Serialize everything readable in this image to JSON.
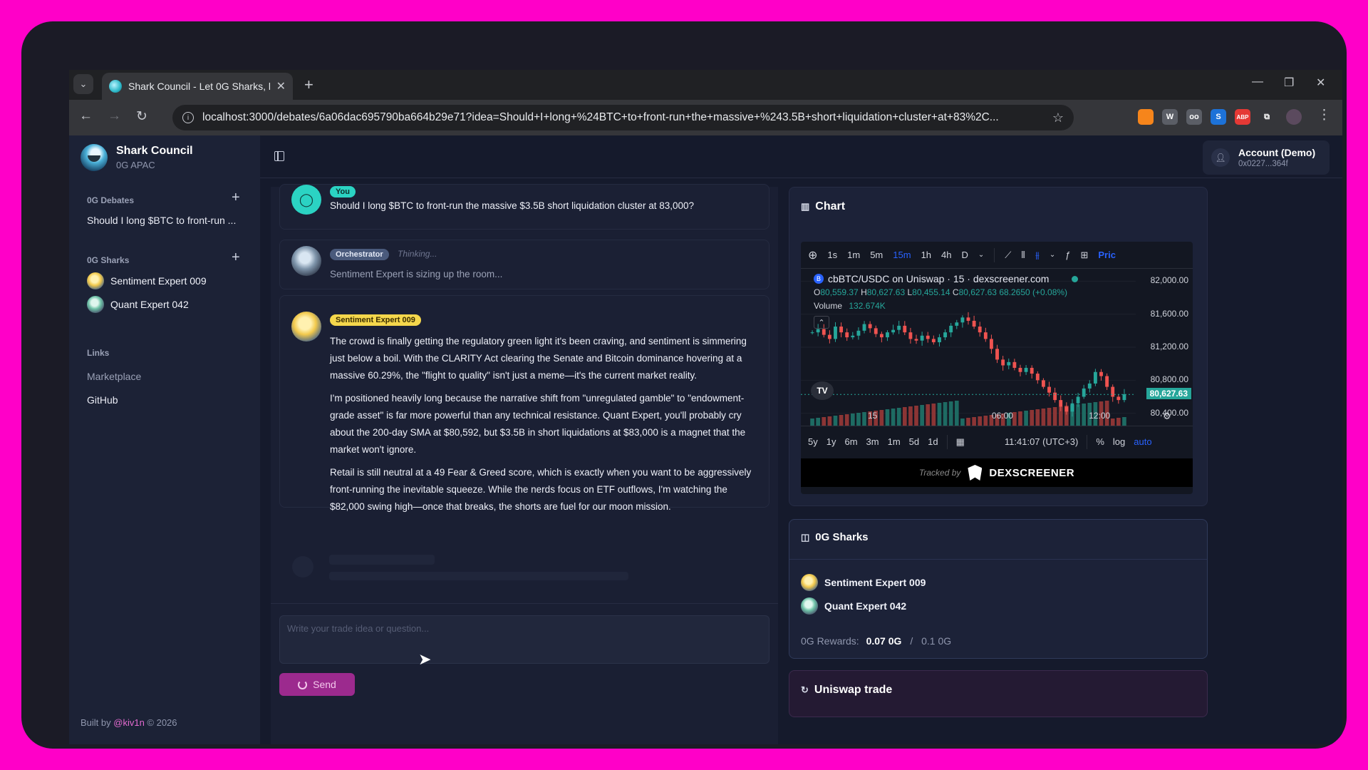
{
  "browser": {
    "tab_title": "Shark Council - Let 0G Sharks, l",
    "url": "localhost:3000/debates/6a06dac695790ba664b29e71?idea=Should+I+long+%24BTC+to+front-run+the+massive+%243.5B+short+liquidation+cluster+at+83%2C...",
    "extensions": [
      {
        "name": "metamask-extension-icon",
        "color": "#f6851b",
        "label": ""
      },
      {
        "name": "wallet-extension-icon",
        "color": "#5b5e66",
        "label": "W"
      },
      {
        "name": "glasses-extension-icon",
        "color": "#5b5e66",
        "label": "oo"
      },
      {
        "name": "s-extension-icon",
        "color": "#1d72d8",
        "label": "S"
      },
      {
        "name": "adblock-extension-icon",
        "color": "#e53935",
        "label": "ABP"
      },
      {
        "name": "puzzle-extension-icon",
        "color": "#35363a",
        "label": "⧉"
      }
    ]
  },
  "sidebar": {
    "brand_name": "Shark Council",
    "brand_sub": "0G APAC",
    "debates_heading": "0G Debates",
    "debate_item": "Should I long $BTC to front-run ...",
    "sharks_heading": "0G Sharks",
    "sharks": [
      {
        "name": "Sentiment Expert 009"
      },
      {
        "name": "Quant Expert 042"
      }
    ],
    "links_heading": "Links",
    "links": [
      "Marketplace",
      "GitHub"
    ],
    "footer_prefix": "Built by ",
    "footer_handle": "@kiv1n",
    "footer_suffix": " © 2026"
  },
  "account": {
    "name": "Account (Demo)",
    "address": "0x0227...364f"
  },
  "chat": {
    "user_badge": "You",
    "user_message": "Should I long $BTC to front-run the massive $3.5B short liquidation cluster at 83,000?",
    "orch_badge": "Orchestrator",
    "orch_status": "Thinking...",
    "orch_message": "Sentiment Expert is sizing up the room...",
    "sent_badge": "Sentiment Expert 009",
    "sent_paragraphs": [
      "The crowd is finally getting the regulatory green light it's been craving, and sentiment is simmering just below a boil. With the CLARITY Act clearing the Senate and Bitcoin dominance hovering at a massive 60.29%, the \"flight to quality\" isn't just a meme—it's the current market reality.",
      "I'm positioned heavily long because the narrative shift from \"unregulated gamble\" to \"endowment-grade asset\" is far more powerful than any technical resistance. Quant Expert, you'll probably cry about the 200-day SMA at $80,592, but $3.5B in short liquidations at $83,000 is a magnet that the market won't ignore.",
      "Retail is still neutral at a 49 Fear & Greed score, which is exactly when you want to be aggressively front-running the inevitable squeeze. While the nerds focus on ETF outflows, I'm watching the $82,000 swing high—once that breaks, the shorts are fuel for our moon mission."
    ],
    "composer_placeholder": "Write your trade idea or question...",
    "send_label": "Send"
  },
  "chart_card": {
    "title": "Chart",
    "intervals": [
      "1s",
      "1m",
      "5m",
      "15m",
      "1h",
      "4h",
      "D"
    ],
    "active_interval": "15m",
    "price_tab": "Pric",
    "symbol": "cbBTC/USDC on Uniswap · 15 · dexscreener.com",
    "ohlc": {
      "o_label": "O",
      "o": "80,559.37",
      "h_label": "H",
      "h": "80,627.63",
      "l_label": "L",
      "l": "80,455.14",
      "c_label": "C",
      "c": "80,627.63",
      "change": "68.2650 (+0.08%)"
    },
    "volume_label": "Volume",
    "volume_value": "132.674K",
    "current_price": "80,627.63",
    "time_labels": [
      "15",
      "06:00",
      "12:00"
    ],
    "ranges": [
      "5y",
      "1y",
      "6m",
      "3m",
      "1m",
      "5d",
      "1d"
    ],
    "clock": "11:41:07 (UTC+3)",
    "pct": "%",
    "log": "log",
    "auto": "auto",
    "tracked_by": "Tracked by",
    "dex_name": "DEXSCREENER",
    "colors": {
      "up": "#26a69a",
      "down": "#ef5350",
      "vol_up": "#1e6b63",
      "vol_down": "#8c3535"
    }
  },
  "chart_data": {
    "type": "candlestick",
    "title": "cbBTC/USDC on Uniswap · 15 · dexscreener.com",
    "y_ticks": [
      82000,
      81600,
      81200,
      80800,
      80400
    ],
    "y_tick_labels": [
      "82,000.00",
      "81,600.00",
      "81,200.00",
      "80,800.00",
      "80,400.00"
    ],
    "ylim": [
      80250,
      82150
    ],
    "x_tick_labels": [
      "15",
      "06:00",
      "12:00"
    ],
    "last_price": 80627.63,
    "close": [
      81380,
      81420,
      81350,
      81300,
      81450,
      81380,
      81320,
      81340,
      81400,
      81480,
      81430,
      81360,
      81320,
      81380,
      81410,
      81460,
      81380,
      81300,
      81280,
      81340,
      81300,
      81260,
      81320,
      81380,
      81460,
      81500,
      81560,
      81520,
      81450,
      81380,
      81300,
      81180,
      81050,
      80980,
      81020,
      80950,
      80900,
      80950,
      80880,
      80800,
      80720,
      80650,
      80560,
      80480,
      80420,
      80520,
      80600,
      80700,
      80760,
      80900,
      80850,
      80720,
      80600,
      80560,
      80630
    ]
  },
  "sharks_card": {
    "title": "0G Sharks",
    "sharks": [
      "Sentiment Expert 009",
      "Quant Expert 042"
    ],
    "rewards_label": "0G Rewards:",
    "rewards_value": "0.07 0G",
    "rewards_sep": "/",
    "rewards_total": "0.1 0G"
  },
  "uniswap_card": {
    "title": "Uniswap trade"
  }
}
